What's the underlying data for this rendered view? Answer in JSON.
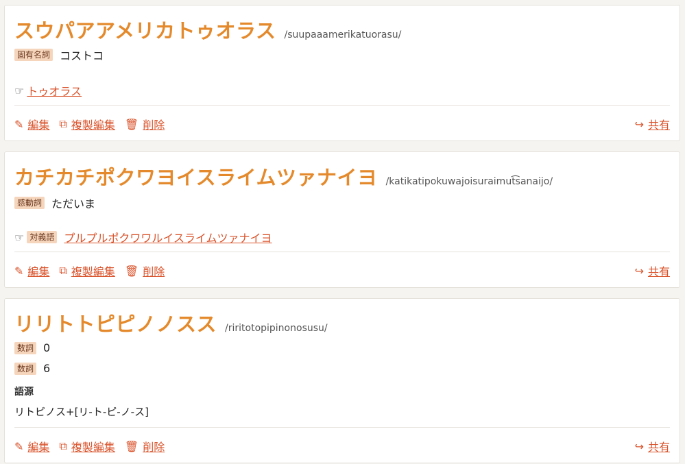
{
  "actions": {
    "edit": "編集",
    "copy_edit": "複製編集",
    "delete": "削除",
    "share": "共有"
  },
  "entries": [
    {
      "word": "スウパアアメリカトゥオラス",
      "pronunciation": "/suupaaamerikatuorasu/",
      "senses": [
        {
          "pos": "固有名詞",
          "def": "コストコ"
        }
      ],
      "relation": {
        "label": "",
        "link": "トゥオラス"
      }
    },
    {
      "word": "カチカチポクワヨイスライムツァナイヨ",
      "pronunciation": "/katikatipokuwajoisuraimut͡sanaijo/",
      "senses": [
        {
          "pos": "感動詞",
          "def": "ただいま"
        }
      ],
      "relation": {
        "label": "対義語",
        "link": "プルプルポクワワルイスライムツァナイヨ"
      }
    },
    {
      "word": "リリトトピピノノスス",
      "pronunciation": "/riritotopipinonosusu/",
      "senses": [
        {
          "pos": "数詞",
          "def": "0"
        },
        {
          "pos": "数詞",
          "def": "6"
        }
      ],
      "etymology": {
        "label": "語源",
        "text": "リトピノス+[リ-ト-ピ-ノ-ス]"
      }
    }
  ],
  "colors": {
    "accent": "#e48a2c",
    "link": "#d9532b",
    "badge": "#f6d5bd"
  },
  "icons": {
    "edit": "edit-icon",
    "copy": "copy-icon",
    "delete": "trash-icon",
    "share": "share-icon",
    "relation": "pointing-hand-icon"
  }
}
